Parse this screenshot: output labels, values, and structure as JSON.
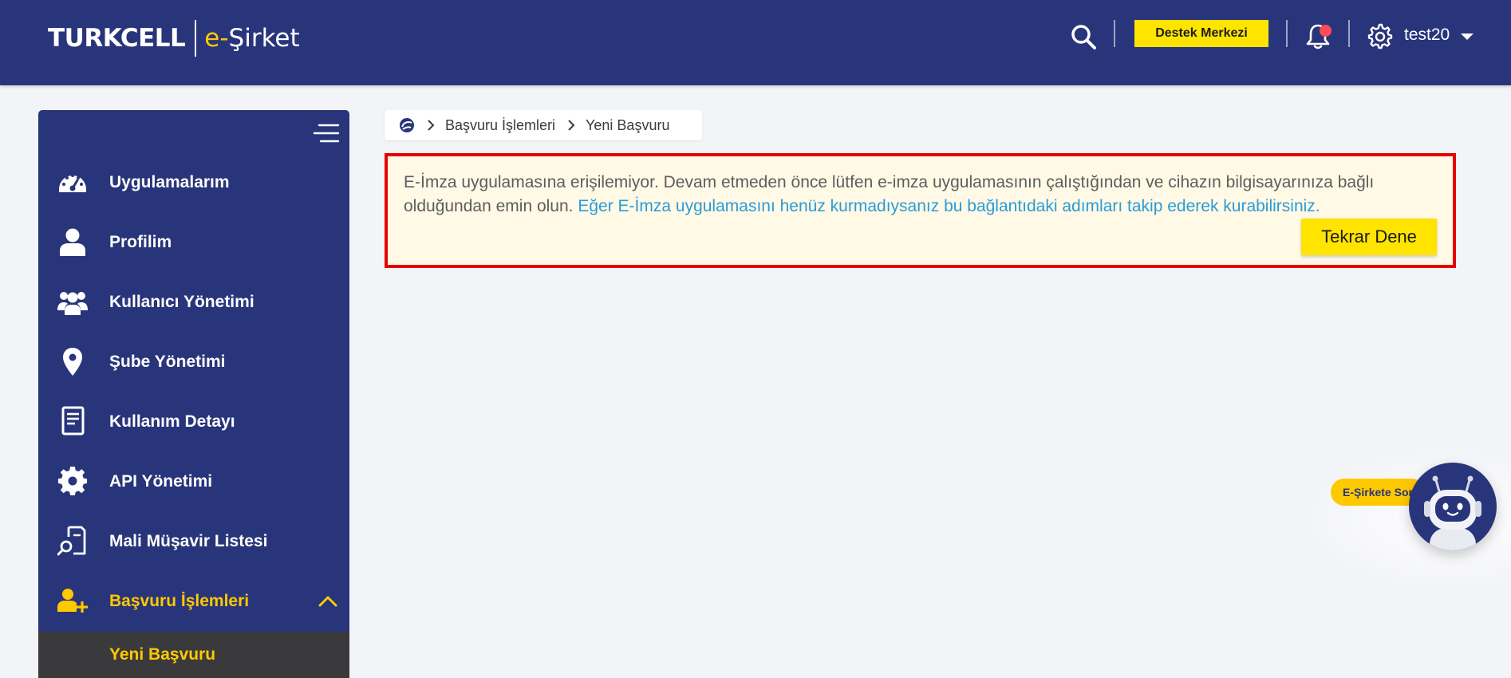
{
  "header": {
    "brand": "TURKCELL",
    "product_e": "e-",
    "product_rest": "Şirket",
    "support_label": "Destek Merkezi",
    "username": "test20"
  },
  "sidebar": {
    "items": [
      {
        "label": "Uygulamalarım",
        "icon": "speedometer-icon"
      },
      {
        "label": "Profilim",
        "icon": "user-icon"
      },
      {
        "label": "Kullanıcı Yönetimi",
        "icon": "users-group-icon"
      },
      {
        "label": "Şube Yönetimi",
        "icon": "location-pin-icon"
      },
      {
        "label": "Kullanım Detayı",
        "icon": "document-icon"
      },
      {
        "label": "API Yönetimi",
        "icon": "gear-icon"
      },
      {
        "label": "Mali Müşavir Listesi",
        "icon": "document-search-icon"
      },
      {
        "label": "Başvuru İşlemleri",
        "icon": "user-add-icon",
        "active": true,
        "expanded": true
      }
    ],
    "sub_items": [
      {
        "label": "Yeni Başvuru"
      }
    ]
  },
  "breadcrumb": {
    "parent": "Başvuru İşlemleri",
    "current": "Yeni Başvuru"
  },
  "alert": {
    "message": "E-İmza uygulamasına erişilemiyor. Devam etmeden önce lütfen e-imza uygulamasının çalıştığından ve cihazın bilgisayarınıza bağlı olduğundan emin olun.",
    "link_text": "Eğer E-İmza uygulamasını henüz kurmadıysanız bu bağlantıdaki adımları takip ederek kurabilirsiniz.",
    "retry_label": "Tekrar Dene"
  },
  "chatbot": {
    "label": "E-Şirkete Sor"
  },
  "colors": {
    "navy": "#29357a",
    "yellow": "#ffe400",
    "accent_yellow": "#ffc900",
    "alert_border": "#e60000",
    "alert_bg": "#fff9e6",
    "link": "#2b9bd8"
  }
}
